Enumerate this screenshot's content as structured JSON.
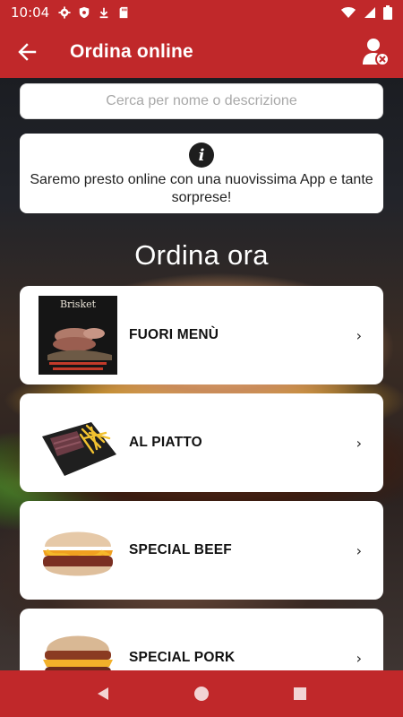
{
  "status_bar": {
    "time": "10:04",
    "icons_left": [
      "gear-icon",
      "shield-icon",
      "download-icon",
      "sd-card-icon"
    ],
    "icons_right": [
      "wifi-icon",
      "signal-icon",
      "battery-icon"
    ]
  },
  "app_bar": {
    "title": "Ordina online",
    "back_icon": "arrow-back-icon",
    "user_icon": "user-logout-icon"
  },
  "search": {
    "placeholder": "Cerca per nome o descrizione",
    "value": ""
  },
  "notice": {
    "icon": "info-icon",
    "text": "Saremo presto online con una nuovissima App e tante sorprese!"
  },
  "section_title": "Ordina ora",
  "categories": [
    {
      "label": "FUORI MENÙ",
      "thumb": "brisket-poster",
      "thumb_text": "Brisket",
      "chevron": "›"
    },
    {
      "label": "AL PIATTO",
      "thumb": "meat-fries-plate",
      "chevron": "›"
    },
    {
      "label": "SPECIAL BEEF",
      "thumb": "beef-burger",
      "chevron": "›"
    },
    {
      "label": "SPECIAL PORK",
      "thumb": "pork-burger",
      "chevron": "›"
    }
  ],
  "nav_bar": {
    "buttons": [
      "back-triangle-icon",
      "home-circle-icon",
      "recents-square-icon"
    ]
  },
  "colors": {
    "primary": "#c0282a",
    "card": "#ffffff",
    "text": "#111111"
  }
}
